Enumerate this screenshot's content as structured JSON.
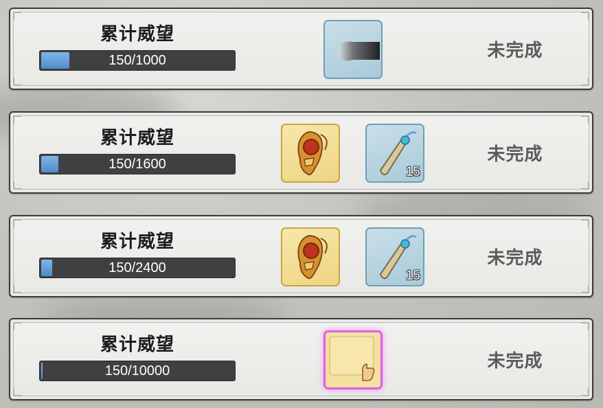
{
  "tasks": [
    {
      "title": "累计威望",
      "progress_text": "150/1000",
      "progress_fraction": 0.15,
      "status": "未完成",
      "rewards": [
        {
          "icon": "dark-cloth-item-icon",
          "frame": "blue",
          "qty": ""
        }
      ]
    },
    {
      "title": "累计威望",
      "progress_text": "150/1600",
      "progress_fraction": 0.094,
      "status": "未完成",
      "rewards": [
        {
          "icon": "amulet-item-icon",
          "frame": "gold",
          "qty": ""
        },
        {
          "icon": "scroll-item-icon",
          "frame": "blue",
          "qty": "15"
        }
      ]
    },
    {
      "title": "累计威望",
      "progress_text": "150/2400",
      "progress_fraction": 0.0625,
      "status": "未完成",
      "rewards": [
        {
          "icon": "amulet-item-icon",
          "frame": "gold",
          "qty": ""
        },
        {
          "icon": "scroll-item-icon",
          "frame": "blue",
          "qty": "15"
        }
      ]
    },
    {
      "title": "累计威望",
      "progress_text": "150/10000",
      "progress_fraction": 0.015,
      "status": "未完成",
      "rewards": [
        {
          "icon": "thumbs-up-card-icon",
          "frame": "purple",
          "qty": ""
        }
      ]
    }
  ]
}
